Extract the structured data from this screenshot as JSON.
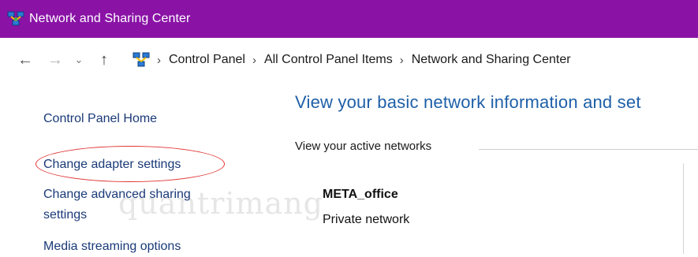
{
  "window": {
    "title": "Network and Sharing Center",
    "title_icon": "network-sharing-icon",
    "titlebar_color": "#8a13a6"
  },
  "navigation": {
    "back_glyph": "←",
    "forward_glyph": "→",
    "recent_glyph": "⌄",
    "up_glyph": "↑",
    "breadcrumb": [
      "Control Panel",
      "All Control Panel Items",
      "Network and Sharing Center"
    ]
  },
  "sidebar": {
    "home": "Control Panel Home",
    "items": [
      "Change adapter settings",
      "Change advanced sharing",
      "settings",
      "Media streaming options"
    ]
  },
  "main": {
    "heading": "View your basic network information and set",
    "active_networks_label": "View your active networks",
    "network": {
      "name": "META_office",
      "type": "Private network"
    }
  },
  "watermark": "quantrimang",
  "colors": {
    "link": "#1a3a78",
    "heading": "#1e5fa8",
    "highlight_ellipse": "#e03434"
  }
}
